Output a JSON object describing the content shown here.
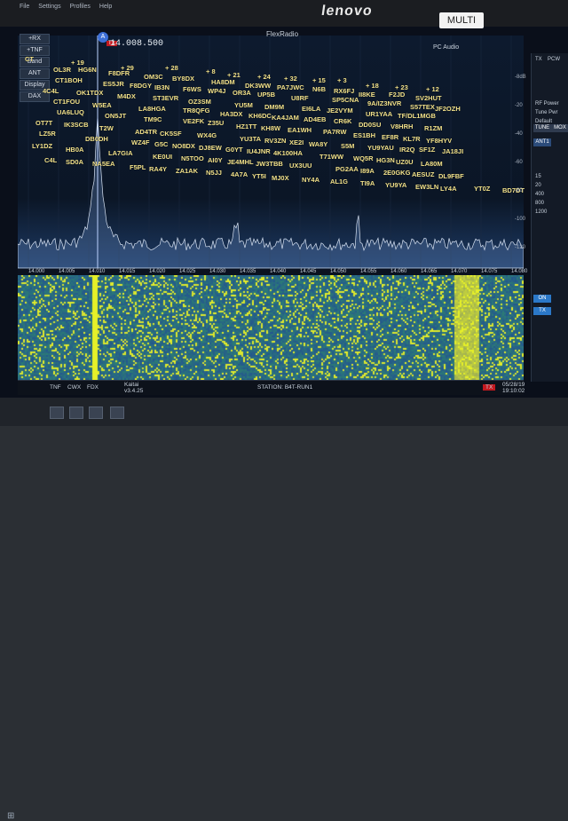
{
  "device": {
    "brand": "lenovo",
    "sticker": "MULTI"
  },
  "menu": [
    "File",
    "Settings",
    "Profiles",
    "Help"
  ],
  "app": {
    "title": "FlexRadio",
    "audio": "PC Audio",
    "callsign_id": "A"
  },
  "slice": {
    "freq": "14.008.500",
    "tx_badge": "TX",
    "id": "A"
  },
  "left_controls": [
    "+RX",
    "+TNF",
    "Band",
    "ANT",
    "Display",
    "DAX"
  ],
  "db_scale": [
    "-8dB",
    "-20",
    "-40",
    "-60",
    "-80",
    "-100",
    "-120"
  ],
  "freq_scale": [
    "14.000",
    "14.005",
    "14.010",
    "14.015",
    "14.020",
    "14.025",
    "14.030",
    "14.035",
    "14.040",
    "14.045",
    "14.050",
    "14.055",
    "14.060",
    "14.065",
    "14.070",
    "14.075",
    "14.080"
  ],
  "spots": [
    [
      "CT",
      28,
      62
    ],
    [
      "+ 19",
      80,
      66
    ],
    [
      "+ 29",
      136,
      72
    ],
    [
      "+ 28",
      186,
      72
    ],
    [
      "+ 8",
      232,
      76
    ],
    [
      "+ 21",
      256,
      80
    ],
    [
      "+ 24",
      290,
      82
    ],
    [
      "+ 32",
      320,
      84
    ],
    [
      "+ 15",
      352,
      86
    ],
    [
      "+ 3",
      380,
      86
    ],
    [
      "+ 18",
      412,
      92
    ],
    [
      "+ 23",
      445,
      94
    ],
    [
      "+ 12",
      480,
      96
    ],
    [
      "OL3R",
      60,
      74
    ],
    [
      "HG6N",
      88,
      74
    ],
    [
      "F8DFR",
      122,
      78
    ],
    [
      "OM3C",
      162,
      82
    ],
    [
      "BY8DX",
      194,
      84
    ],
    [
      "HA8DM",
      238,
      88
    ],
    [
      "DK3WW",
      276,
      92
    ],
    [
      "PA7JWC",
      312,
      94
    ],
    [
      "N6B",
      352,
      96
    ],
    [
      "RX6FJ",
      376,
      98
    ],
    [
      "II8KE",
      404,
      102
    ],
    [
      "F2JD",
      438,
      102
    ],
    [
      "SV2HUT",
      468,
      106
    ],
    [
      "CT1BOH",
      62,
      86
    ],
    [
      "ES5JR",
      116,
      90
    ],
    [
      "F8DGY",
      146,
      92
    ],
    [
      "IB3N",
      174,
      94
    ],
    [
      "F6WS",
      206,
      96
    ],
    [
      "WP4J",
      234,
      98
    ],
    [
      "OR3A",
      262,
      100
    ],
    [
      "UP5B",
      290,
      102
    ],
    [
      "U8RF",
      328,
      106
    ],
    [
      "SP5CNA",
      374,
      108
    ],
    [
      "9A/IZ3NVR",
      414,
      112
    ],
    [
      "S57TEX",
      462,
      116
    ],
    [
      "JF2OZH",
      490,
      118
    ],
    [
      "4C4L",
      48,
      98
    ],
    [
      "OK1TDX",
      86,
      100
    ],
    [
      "M4DX",
      132,
      104
    ],
    [
      "ST3EVR",
      172,
      106
    ],
    [
      "OZ3SM",
      212,
      110
    ],
    [
      "YU5M",
      264,
      114
    ],
    [
      "DM9M",
      298,
      116
    ],
    [
      "EI6LA",
      340,
      118
    ],
    [
      "JE2VYM",
      368,
      120
    ],
    [
      "UR1YAA",
      412,
      124
    ],
    [
      "TF/DL1MGB",
      448,
      126
    ],
    [
      "CT1FOU",
      60,
      110
    ],
    [
      "W5EA",
      104,
      114
    ],
    [
      "LA8HGA",
      156,
      118
    ],
    [
      "TR8QFG",
      206,
      120
    ],
    [
      "HA3DX",
      248,
      124
    ],
    [
      "KH6DC",
      280,
      126
    ],
    [
      "KA4JAM",
      306,
      128
    ],
    [
      "AD4EB",
      342,
      130
    ],
    [
      "CR6K",
      376,
      132
    ],
    [
      "DD0SU",
      404,
      136
    ],
    [
      "V8HRH",
      440,
      138
    ],
    [
      "R1ZM",
      478,
      140
    ],
    [
      "UA6LUQ",
      64,
      122
    ],
    [
      "ON5JT",
      118,
      126
    ],
    [
      "TM9C",
      162,
      130
    ],
    [
      "VE2FK",
      206,
      132
    ],
    [
      "Z35U",
      234,
      134
    ],
    [
      "HZ1TT",
      266,
      138
    ],
    [
      "KH8W",
      294,
      140
    ],
    [
      "EA1WH",
      324,
      142
    ],
    [
      "PA7RW",
      364,
      144
    ],
    [
      "ES1BH",
      398,
      148
    ],
    [
      "EF8R",
      430,
      150
    ],
    [
      "KL7R",
      454,
      152
    ],
    [
      "YF8HYV",
      480,
      154
    ],
    [
      "OT7T",
      40,
      134
    ],
    [
      "IK3SCB",
      72,
      136
    ],
    [
      "T2W",
      112,
      140
    ],
    [
      "AD4TR",
      152,
      144
    ],
    [
      "CK5SF",
      180,
      146
    ],
    [
      "WX4G",
      222,
      148
    ],
    [
      "YU3TA",
      270,
      152
    ],
    [
      "RV3ZN",
      298,
      154
    ],
    [
      "XE2I",
      326,
      156
    ],
    [
      "WA8Y",
      348,
      158
    ],
    [
      "S5M",
      384,
      160
    ],
    [
      "YU9YAU",
      414,
      162
    ],
    [
      "IR2Q",
      450,
      164
    ],
    [
      "SF1Z",
      472,
      164
    ],
    [
      "JA18JI",
      498,
      166
    ],
    [
      "LZ5R",
      44,
      146
    ],
    [
      "DB0DH",
      96,
      152
    ],
    [
      "WZ4F",
      148,
      156
    ],
    [
      "G5C",
      174,
      158
    ],
    [
      "NO8DX",
      194,
      160
    ],
    [
      "DJ8EW",
      224,
      162
    ],
    [
      "G0YT",
      254,
      164
    ],
    [
      "IU4JNR",
      278,
      166
    ],
    [
      "4K100HA",
      308,
      168
    ],
    [
      "T71WW",
      360,
      172
    ],
    [
      "WQ5R",
      398,
      174
    ],
    [
      "HG3N",
      424,
      176
    ],
    [
      "UZ0U",
      446,
      178
    ],
    [
      "LA80M",
      474,
      180
    ],
    [
      "LY1DZ",
      36,
      160
    ],
    [
      "HB0A",
      74,
      164
    ],
    [
      "LA7GIA",
      122,
      168
    ],
    [
      "KE0UI",
      172,
      172
    ],
    [
      "N5TOO",
      204,
      174
    ],
    [
      "AI0Y",
      234,
      176
    ],
    [
      "JE4MHL",
      256,
      178
    ],
    [
      "JW3TBB",
      288,
      180
    ],
    [
      "UX3UU",
      326,
      182
    ],
    [
      "PG2AA",
      378,
      186
    ],
    [
      "I89A",
      406,
      188
    ],
    [
      "2E0GKG",
      432,
      190
    ],
    [
      "AESUZ",
      464,
      192
    ],
    [
      "DL9FBF",
      494,
      194
    ],
    [
      "C4L",
      50,
      176
    ],
    [
      "SD0A",
      74,
      178
    ],
    [
      "NA5EA",
      104,
      180
    ],
    [
      "F5PL",
      146,
      184
    ],
    [
      "RA4Y",
      168,
      186
    ],
    [
      "ZA1AK",
      198,
      188
    ],
    [
      "N5JJ",
      232,
      190
    ],
    [
      "4A7A",
      260,
      192
    ],
    [
      "YT5I",
      284,
      194
    ],
    [
      "MJ0X",
      306,
      196
    ],
    [
      "NY4A",
      340,
      198
    ],
    [
      "AL1G",
      372,
      200
    ],
    [
      "TI9A",
      406,
      202
    ],
    [
      "YU9YA",
      434,
      204
    ],
    [
      "EW3LN",
      468,
      206
    ],
    [
      "LY4A",
      496,
      208
    ],
    [
      "YT0Z",
      534,
      208
    ],
    [
      "BD7DT",
      566,
      210
    ]
  ],
  "right_panel": {
    "tx_label": "TX",
    "pc_label": "PCW",
    "rf_label": "RF Power",
    "tune_label": "Tune Pwr",
    "default": "Default",
    "tune": "TUNE",
    "mox": "MOX",
    "ant": "ANT1",
    "on": "ON",
    "tx": "TX",
    "vals": [
      "15",
      "20",
      "400",
      "800",
      "1200"
    ]
  },
  "status": {
    "tnf": "TNF",
    "cwx": "CWX",
    "fdx": "FDX",
    "app": "Kaitai",
    "version": "v3.4.25",
    "station": "STATION: B4T-RUN1",
    "tx": "TX",
    "time": "05/28/19",
    "clock": "19:10:02"
  },
  "colors": {
    "spot": "#f2e28c",
    "waterfall_low": "#1f3f9a",
    "waterfall_high": "#f5e646",
    "tx_red": "#c2191f"
  }
}
